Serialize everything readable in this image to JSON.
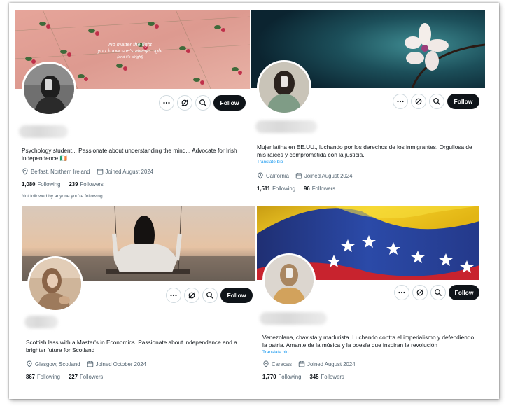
{
  "profiles": [
    {
      "banner_text": [
        "No matter the fight",
        "you know she's always right",
        "(and it's alright)"
      ],
      "bio": "Psychology student... Passionate about understanding the mind... Advocate for Irish independence 🇮🇪",
      "translate": "",
      "location": "Belfast, Northern Ireland",
      "joined": "Joined August 2024",
      "following_count": "1,080",
      "following_label": "Following",
      "followers_count": "239",
      "followers_label": "Followers",
      "note": "Not followed by anyone you're following",
      "follow_label": "Follow"
    },
    {
      "bio": "Mujer latina en EE.UU., luchando por los derechos de los inmigrantes. Orgullosa de mis raíces y comprometida con la justicia.",
      "translate": "Translate bio",
      "location": "California",
      "joined": "Joined August 2024",
      "following_count": "1,511",
      "following_label": "Following",
      "followers_count": "96",
      "followers_label": "Followers",
      "follow_label": "Follow"
    },
    {
      "bio": "Scottish lass with a Master's in Economics. Passionate about independence and a brighter future for Scotland",
      "translate": "",
      "location": "Glasgow, Scotland",
      "joined": "Joined October 2024",
      "following_count": "867",
      "following_label": "Following",
      "followers_count": "227",
      "followers_label": "Followers",
      "follow_label": "Follow"
    },
    {
      "bio": "Venezolana, chavista y madurista. Luchando contra el imperialismo y defendiendo la patria. Amante de la música y la poesía que inspiran la revolución",
      "translate": "Translate bio",
      "location": "Caracas",
      "joined": "Joined August 2024",
      "following_count": "1,770",
      "following_label": "Following",
      "followers_count": "345",
      "followers_label": "Followers",
      "follow_label": "Follow"
    }
  ],
  "icons": {
    "more": "more-dots-icon",
    "grok": "grok-icon",
    "search": "search-icon",
    "location": "location-pin-icon",
    "calendar": "calendar-icon"
  },
  "colors": {
    "follow_button": "#0f1419",
    "link": "#1d9bf0",
    "secondary_text": "#536471"
  }
}
